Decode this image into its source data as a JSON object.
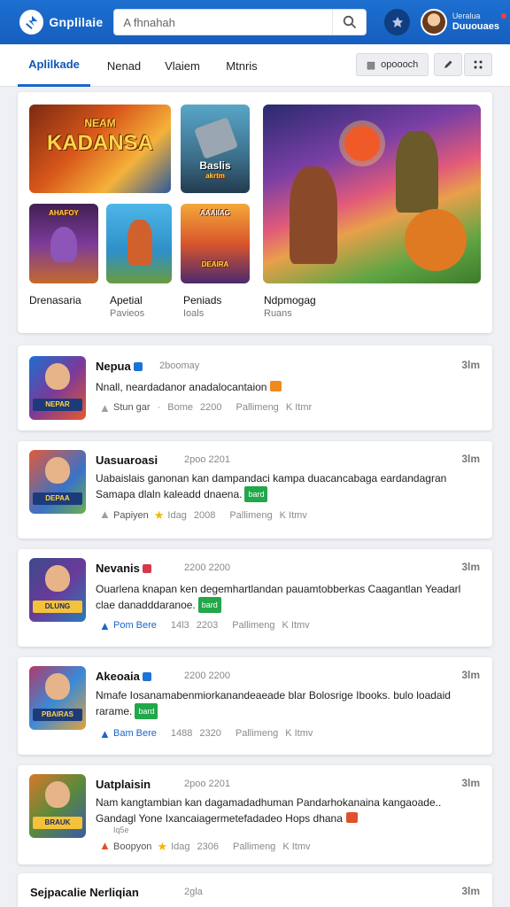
{
  "header": {
    "app_title": "Gnplilaie",
    "search_placeholder": "A fhnahah",
    "user_line1": "Ueralua",
    "user_line2": "Duuouaes"
  },
  "tabs": [
    {
      "label": "Aplilkade",
      "active": true
    },
    {
      "label": "Nenad"
    },
    {
      "label": "Vlaiem"
    },
    {
      "label": "Mtnris"
    }
  ],
  "toolbar": {
    "action_label": "opoooch"
  },
  "featured": {
    "items": [
      {
        "label": "Drenasaria",
        "sub": ""
      },
      {
        "label": "Apetial",
        "sub": "Pavieos"
      },
      {
        "label": "Peniads",
        "sub": "Ioals"
      },
      {
        "label": "Ndpmogag",
        "sub": "Ruans"
      }
    ],
    "art": {
      "kadansa": "KADANSA",
      "kadansa_top": "NEAM",
      "tile2_line1": "Baslis",
      "tile2_line2": "akrtm",
      "tile3": "AHAFOY",
      "tile5": "AAAIIAG",
      "tile5b": "DEAIRA"
    }
  },
  "posts": [
    {
      "title": "Nepua",
      "meta": "2boomay",
      "time": "3lm",
      "desc": "Nnall, neardadanor anadalocantaion",
      "thumb_text": "NEPAR",
      "foot": [
        "Stun gar",
        "Bome",
        "2200",
        "Pallimeng",
        "K Itmr"
      ]
    },
    {
      "title": "Uasuaroasi",
      "meta": "2poo 2201",
      "time": "3lm",
      "desc": "Uabaislais ganonan kan dampandaci kampa duacancabaga eardandagran Samapa dlaln kaleadd dnaena.",
      "badge": "bard",
      "thumb_text": "DEPAA",
      "foot": [
        "Papiyen",
        "Idag",
        "2008",
        "Pallimeng",
        "K Itmv"
      ]
    },
    {
      "title": "Nevanis",
      "meta": "2200 2200",
      "time": "3lm",
      "desc": "Ouarlena knapan ken degemhartlandan pauamtobberkas Caagantlan Yeadarl clae danadddaranoe.",
      "badge": "bard",
      "thumb_text": "DLUNG",
      "foot": [
        "Pom Bere",
        "14l3",
        "2203",
        "Pallimeng",
        "K Itmv"
      ]
    },
    {
      "title": "Akeoaia",
      "meta": "2200 2200",
      "time": "3lm",
      "desc": "Nmafe Iosanamabenmiorkanandeaeade blar Bolosrige Ibooks. bulo loadaid rarame.",
      "badge": "bard",
      "thumb_text": "PBAIRAS",
      "foot": [
        "Bam Bere",
        "1488",
        "2320",
        "Pallimeng",
        "K Itmv"
      ]
    },
    {
      "title": "Uatplaisin",
      "meta": "2poo 2201",
      "time": "3lm",
      "desc": "Nam kangtambian kan dagamadadhuman Pandarhokanaina kangaoade.. Gandagl Yone Ixancaiagermetefadadeo Hops dhana",
      "extra": "Iq5e",
      "thumb_text": "BRAUK",
      "foot": [
        "Boopyon",
        "Idag",
        "2306",
        "Pallimeng",
        "K Itmv"
      ]
    },
    {
      "title": "Sejpacalie Nerliqian",
      "meta": "2gla",
      "time": "3lm"
    }
  ]
}
